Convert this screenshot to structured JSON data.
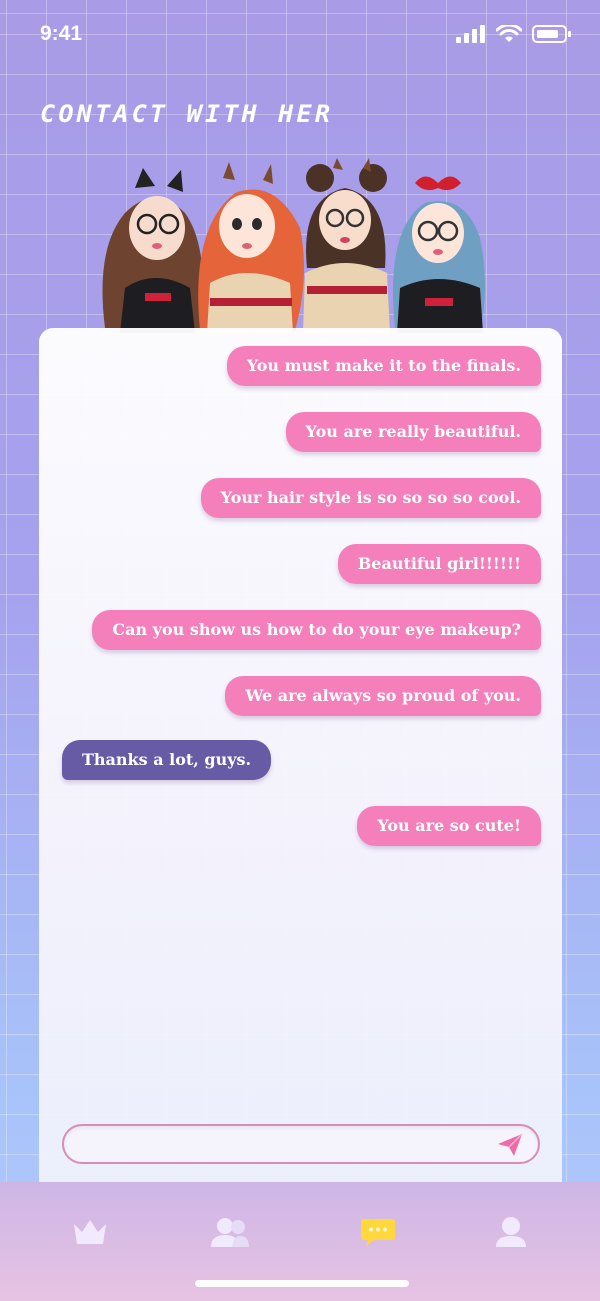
{
  "status": {
    "time": "9:41"
  },
  "header": {
    "title": "CONTACT WITH HER"
  },
  "colors": {
    "outgoing": "#f47fbb",
    "incoming": "#675ba6",
    "active_tab": "#ffd83d",
    "tab_icon": "#f1eafc"
  },
  "messages": [
    {
      "text": "You must make it to the finals.",
      "side": "out"
    },
    {
      "text": "You are really beautiful.",
      "side": "out"
    },
    {
      "text": "Your hair style is so so so so cool.",
      "side": "out"
    },
    {
      "text": "Beautiful girl!!!!!!",
      "side": "out"
    },
    {
      "text": "Can you show us how to do your eye makeup?",
      "side": "out"
    },
    {
      "text": "We are always so proud of you.",
      "side": "out"
    },
    {
      "text": "Thanks a lot, guys.",
      "side": "in"
    },
    {
      "text": "You are so cute!",
      "side": "out"
    }
  ],
  "composer": {
    "value": "",
    "send_icon": "send-icon"
  },
  "tabs": [
    {
      "icon": "crown-icon"
    },
    {
      "icon": "friends-icon"
    },
    {
      "icon": "chat-icon",
      "active": true
    },
    {
      "icon": "profile-icon"
    }
  ]
}
